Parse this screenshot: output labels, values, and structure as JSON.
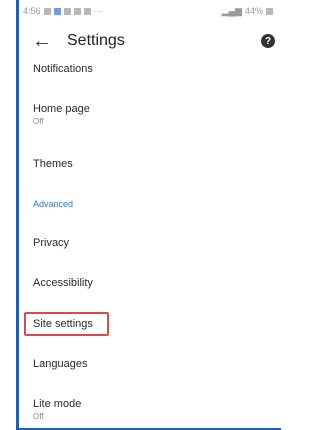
{
  "status_bar": {
    "time": "4:56",
    "right_text": "44%"
  },
  "app_bar": {
    "back_icon": "arrow-left-icon",
    "title": "Settings",
    "help_icon": "help-circle-icon"
  },
  "settings": {
    "notifications": "Notifications",
    "home_page": "Home page",
    "home_page_value": "Off",
    "themes": "Themes",
    "advanced_header": "Advanced",
    "privacy": "Privacy",
    "accessibility": "Accessibility",
    "site_settings": "Site settings",
    "languages": "Languages",
    "lite_mode": "Lite mode",
    "lite_mode_value": "Off"
  },
  "colors": {
    "accent": "#3a74d4",
    "highlight": "#e04848",
    "frame": "#1f5fb8"
  }
}
